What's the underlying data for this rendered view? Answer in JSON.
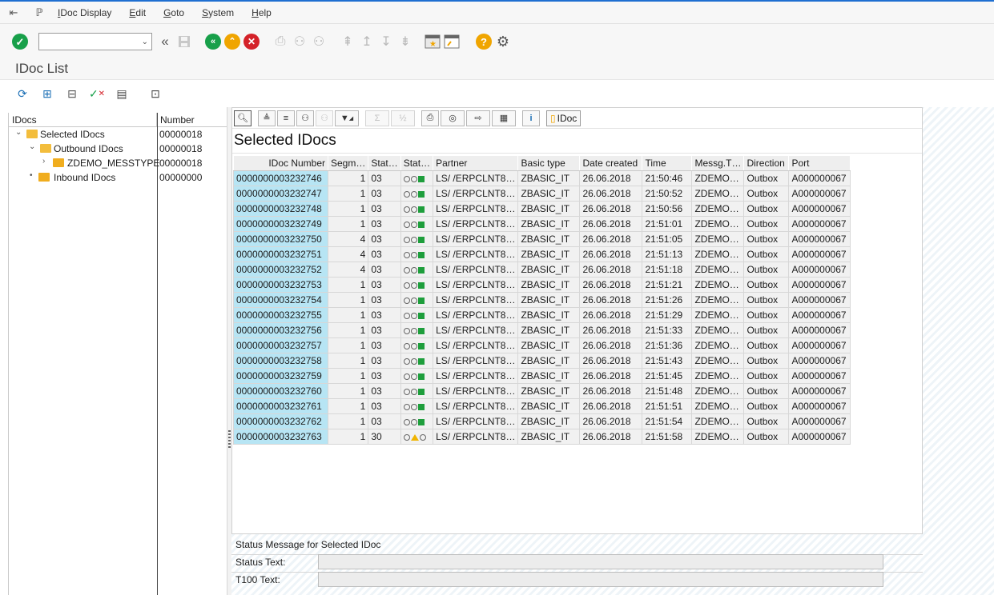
{
  "menu": {
    "items": [
      {
        "label": "IDoc Display",
        "ul": "I",
        "rest": "Doc Display"
      },
      {
        "label": "Edit",
        "ul": "E",
        "rest": "dit"
      },
      {
        "label": "Goto",
        "ul": "G",
        "rest": "oto"
      },
      {
        "label": "System",
        "ul": "S",
        "rest": "ystem"
      },
      {
        "label": "Help",
        "ul": "H",
        "rest": "elp"
      }
    ]
  },
  "toolbar": {
    "command_value": ""
  },
  "title": "IDoc List",
  "tree": {
    "col_idocs": "IDocs",
    "col_number": "Number",
    "nodes": [
      {
        "label": "Selected IDocs",
        "number": "00000018",
        "level": 0
      },
      {
        "label": "Outbound IDocs",
        "number": "00000018",
        "level": 1
      },
      {
        "label": "ZDEMO_MESSTYPE",
        "number": "00000018",
        "level": 2
      },
      {
        "label": "Inbound IDocs",
        "number": "00000000",
        "level": 0
      }
    ]
  },
  "alv": {
    "idoc_button": "IDoc",
    "title": "Selected IDocs",
    "columns": [
      "IDoc Number",
      "Segm…",
      "Stat…",
      "Stat…",
      "Partner",
      "Basic type",
      "Date created",
      "Time",
      "Messg.T…",
      "Direction",
      "Port"
    ],
    "rows": [
      {
        "idoc": "0000000003232746",
        "segm": "1",
        "stat": "03",
        "light": "green",
        "partner": "LS/  /ERPCLNT8…",
        "basic": "ZBASIC_IT",
        "date": "26.06.2018",
        "time": "21:50:46",
        "mtype": "ZDEMO…",
        "dir": "Outbox",
        "port": "A000000067"
      },
      {
        "idoc": "0000000003232747",
        "segm": "1",
        "stat": "03",
        "light": "green",
        "partner": "LS/  /ERPCLNT8…",
        "basic": "ZBASIC_IT",
        "date": "26.06.2018",
        "time": "21:50:52",
        "mtype": "ZDEMO…",
        "dir": "Outbox",
        "port": "A000000067"
      },
      {
        "idoc": "0000000003232748",
        "segm": "1",
        "stat": "03",
        "light": "green",
        "partner": "LS/  /ERPCLNT8…",
        "basic": "ZBASIC_IT",
        "date": "26.06.2018",
        "time": "21:50:56",
        "mtype": "ZDEMO…",
        "dir": "Outbox",
        "port": "A000000067"
      },
      {
        "idoc": "0000000003232749",
        "segm": "1",
        "stat": "03",
        "light": "green",
        "partner": "LS/  /ERPCLNT8…",
        "basic": "ZBASIC_IT",
        "date": "26.06.2018",
        "time": "21:51:01",
        "mtype": "ZDEMO…",
        "dir": "Outbox",
        "port": "A000000067"
      },
      {
        "idoc": "0000000003232750",
        "segm": "4",
        "stat": "03",
        "light": "green",
        "partner": "LS/  /ERPCLNT8…",
        "basic": "ZBASIC_IT",
        "date": "26.06.2018",
        "time": "21:51:05",
        "mtype": "ZDEMO…",
        "dir": "Outbox",
        "port": "A000000067"
      },
      {
        "idoc": "0000000003232751",
        "segm": "4",
        "stat": "03",
        "light": "green",
        "partner": "LS/  /ERPCLNT8…",
        "basic": "ZBASIC_IT",
        "date": "26.06.2018",
        "time": "21:51:13",
        "mtype": "ZDEMO…",
        "dir": "Outbox",
        "port": "A000000067"
      },
      {
        "idoc": "0000000003232752",
        "segm": "4",
        "stat": "03",
        "light": "green",
        "partner": "LS/  /ERPCLNT8…",
        "basic": "ZBASIC_IT",
        "date": "26.06.2018",
        "time": "21:51:18",
        "mtype": "ZDEMO…",
        "dir": "Outbox",
        "port": "A000000067"
      },
      {
        "idoc": "0000000003232753",
        "segm": "1",
        "stat": "03",
        "light": "green",
        "partner": "LS/  /ERPCLNT8…",
        "basic": "ZBASIC_IT",
        "date": "26.06.2018",
        "time": "21:51:21",
        "mtype": "ZDEMO…",
        "dir": "Outbox",
        "port": "A000000067"
      },
      {
        "idoc": "0000000003232754",
        "segm": "1",
        "stat": "03",
        "light": "green",
        "partner": "LS/  /ERPCLNT8…",
        "basic": "ZBASIC_IT",
        "date": "26.06.2018",
        "time": "21:51:26",
        "mtype": "ZDEMO…",
        "dir": "Outbox",
        "port": "A000000067"
      },
      {
        "idoc": "0000000003232755",
        "segm": "1",
        "stat": "03",
        "light": "green",
        "partner": "LS/  /ERPCLNT8…",
        "basic": "ZBASIC_IT",
        "date": "26.06.2018",
        "time": "21:51:29",
        "mtype": "ZDEMO…",
        "dir": "Outbox",
        "port": "A000000067"
      },
      {
        "idoc": "0000000003232756",
        "segm": "1",
        "stat": "03",
        "light": "green",
        "partner": "LS/  /ERPCLNT8…",
        "basic": "ZBASIC_IT",
        "date": "26.06.2018",
        "time": "21:51:33",
        "mtype": "ZDEMO…",
        "dir": "Outbox",
        "port": "A000000067"
      },
      {
        "idoc": "0000000003232757",
        "segm": "1",
        "stat": "03",
        "light": "green",
        "partner": "LS/  /ERPCLNT8…",
        "basic": "ZBASIC_IT",
        "date": "26.06.2018",
        "time": "21:51:36",
        "mtype": "ZDEMO…",
        "dir": "Outbox",
        "port": "A000000067"
      },
      {
        "idoc": "0000000003232758",
        "segm": "1",
        "stat": "03",
        "light": "green",
        "partner": "LS/  /ERPCLNT8…",
        "basic": "ZBASIC_IT",
        "date": "26.06.2018",
        "time": "21:51:43",
        "mtype": "ZDEMO…",
        "dir": "Outbox",
        "port": "A000000067"
      },
      {
        "idoc": "0000000003232759",
        "segm": "1",
        "stat": "03",
        "light": "green",
        "partner": "LS/  /ERPCLNT8…",
        "basic": "ZBASIC_IT",
        "date": "26.06.2018",
        "time": "21:51:45",
        "mtype": "ZDEMO…",
        "dir": "Outbox",
        "port": "A000000067"
      },
      {
        "idoc": "0000000003232760",
        "segm": "1",
        "stat": "03",
        "light": "green",
        "partner": "LS/  /ERPCLNT8…",
        "basic": "ZBASIC_IT",
        "date": "26.06.2018",
        "time": "21:51:48",
        "mtype": "ZDEMO…",
        "dir": "Outbox",
        "port": "A000000067"
      },
      {
        "idoc": "0000000003232761",
        "segm": "1",
        "stat": "03",
        "light": "green",
        "partner": "LS/  /ERPCLNT8…",
        "basic": "ZBASIC_IT",
        "date": "26.06.2018",
        "time": "21:51:51",
        "mtype": "ZDEMO…",
        "dir": "Outbox",
        "port": "A000000067"
      },
      {
        "idoc": "0000000003232762",
        "segm": "1",
        "stat": "03",
        "light": "green",
        "partner": "LS/  /ERPCLNT8…",
        "basic": "ZBASIC_IT",
        "date": "26.06.2018",
        "time": "21:51:54",
        "mtype": "ZDEMO…",
        "dir": "Outbox",
        "port": "A000000067"
      },
      {
        "idoc": "0000000003232763",
        "segm": "1",
        "stat": "30",
        "light": "yellow",
        "partner": "LS/  /ERPCLNT8…",
        "basic": "ZBASIC_IT",
        "date": "26.06.2018",
        "time": "21:51:58",
        "mtype": "ZDEMO…",
        "dir": "Outbox",
        "port": "A000000067"
      }
    ]
  },
  "status": {
    "heading": "Status Message for Selected IDoc",
    "status_text_label": "Status Text:",
    "status_text_value": "",
    "t100_label": "T100 Text:",
    "t100_value": ""
  },
  "colors": {
    "accent": "#1f6fd1",
    "key_cell": "#b7e5f4",
    "light_green": "#1e9e3c",
    "light_yellow": "#f0b400"
  }
}
